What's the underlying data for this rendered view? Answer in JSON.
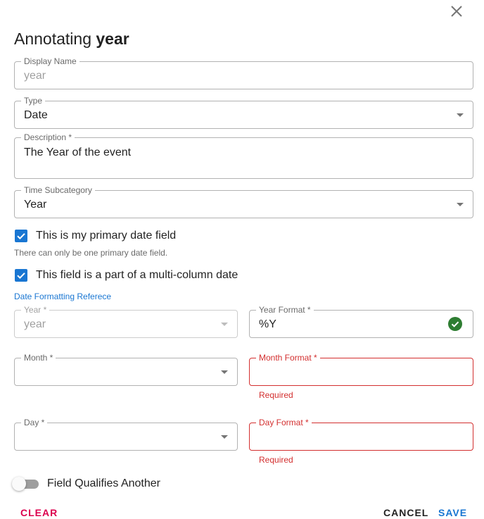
{
  "dialog": {
    "title_prefix": "Annotating",
    "title_column": "year"
  },
  "fields": {
    "display_name": {
      "label": "Display Name",
      "placeholder": "year"
    },
    "type": {
      "label": "Type",
      "value": "Date"
    },
    "description": {
      "label": "Description *",
      "value": "The Year of the event"
    },
    "time_subcategory": {
      "label": "Time Subcategory",
      "value": "Year"
    }
  },
  "checkboxes": {
    "primary_date": {
      "label": "This is my primary date field",
      "checked": true,
      "helper": "There can only be one primary date field."
    },
    "multi_column": {
      "label": "This field is a part of a multi-column date",
      "checked": true
    }
  },
  "date_formatting_link": "Date Formatting Referece",
  "multi_column_date": {
    "year": {
      "label": "Year *",
      "placeholder": "year"
    },
    "year_format": {
      "label": "Year Format *",
      "value": "%Y",
      "valid": true
    },
    "month": {
      "label": "Month *",
      "value": ""
    },
    "month_format": {
      "label": "Month Format *",
      "value": "",
      "error": "Required"
    },
    "day": {
      "label": "Day *",
      "value": ""
    },
    "day_format": {
      "label": "Day Format *",
      "value": "",
      "error": "Required"
    }
  },
  "qualifies_switch": {
    "label": "Field Qualifies Another",
    "on": false
  },
  "actions": {
    "clear": "CLEAR",
    "cancel": "CANCEL",
    "save": "SAVE"
  },
  "colors": {
    "primary": "#1976d2",
    "error": "#d32f2f",
    "success": "#2e7d32",
    "clear": "#dc004e"
  }
}
